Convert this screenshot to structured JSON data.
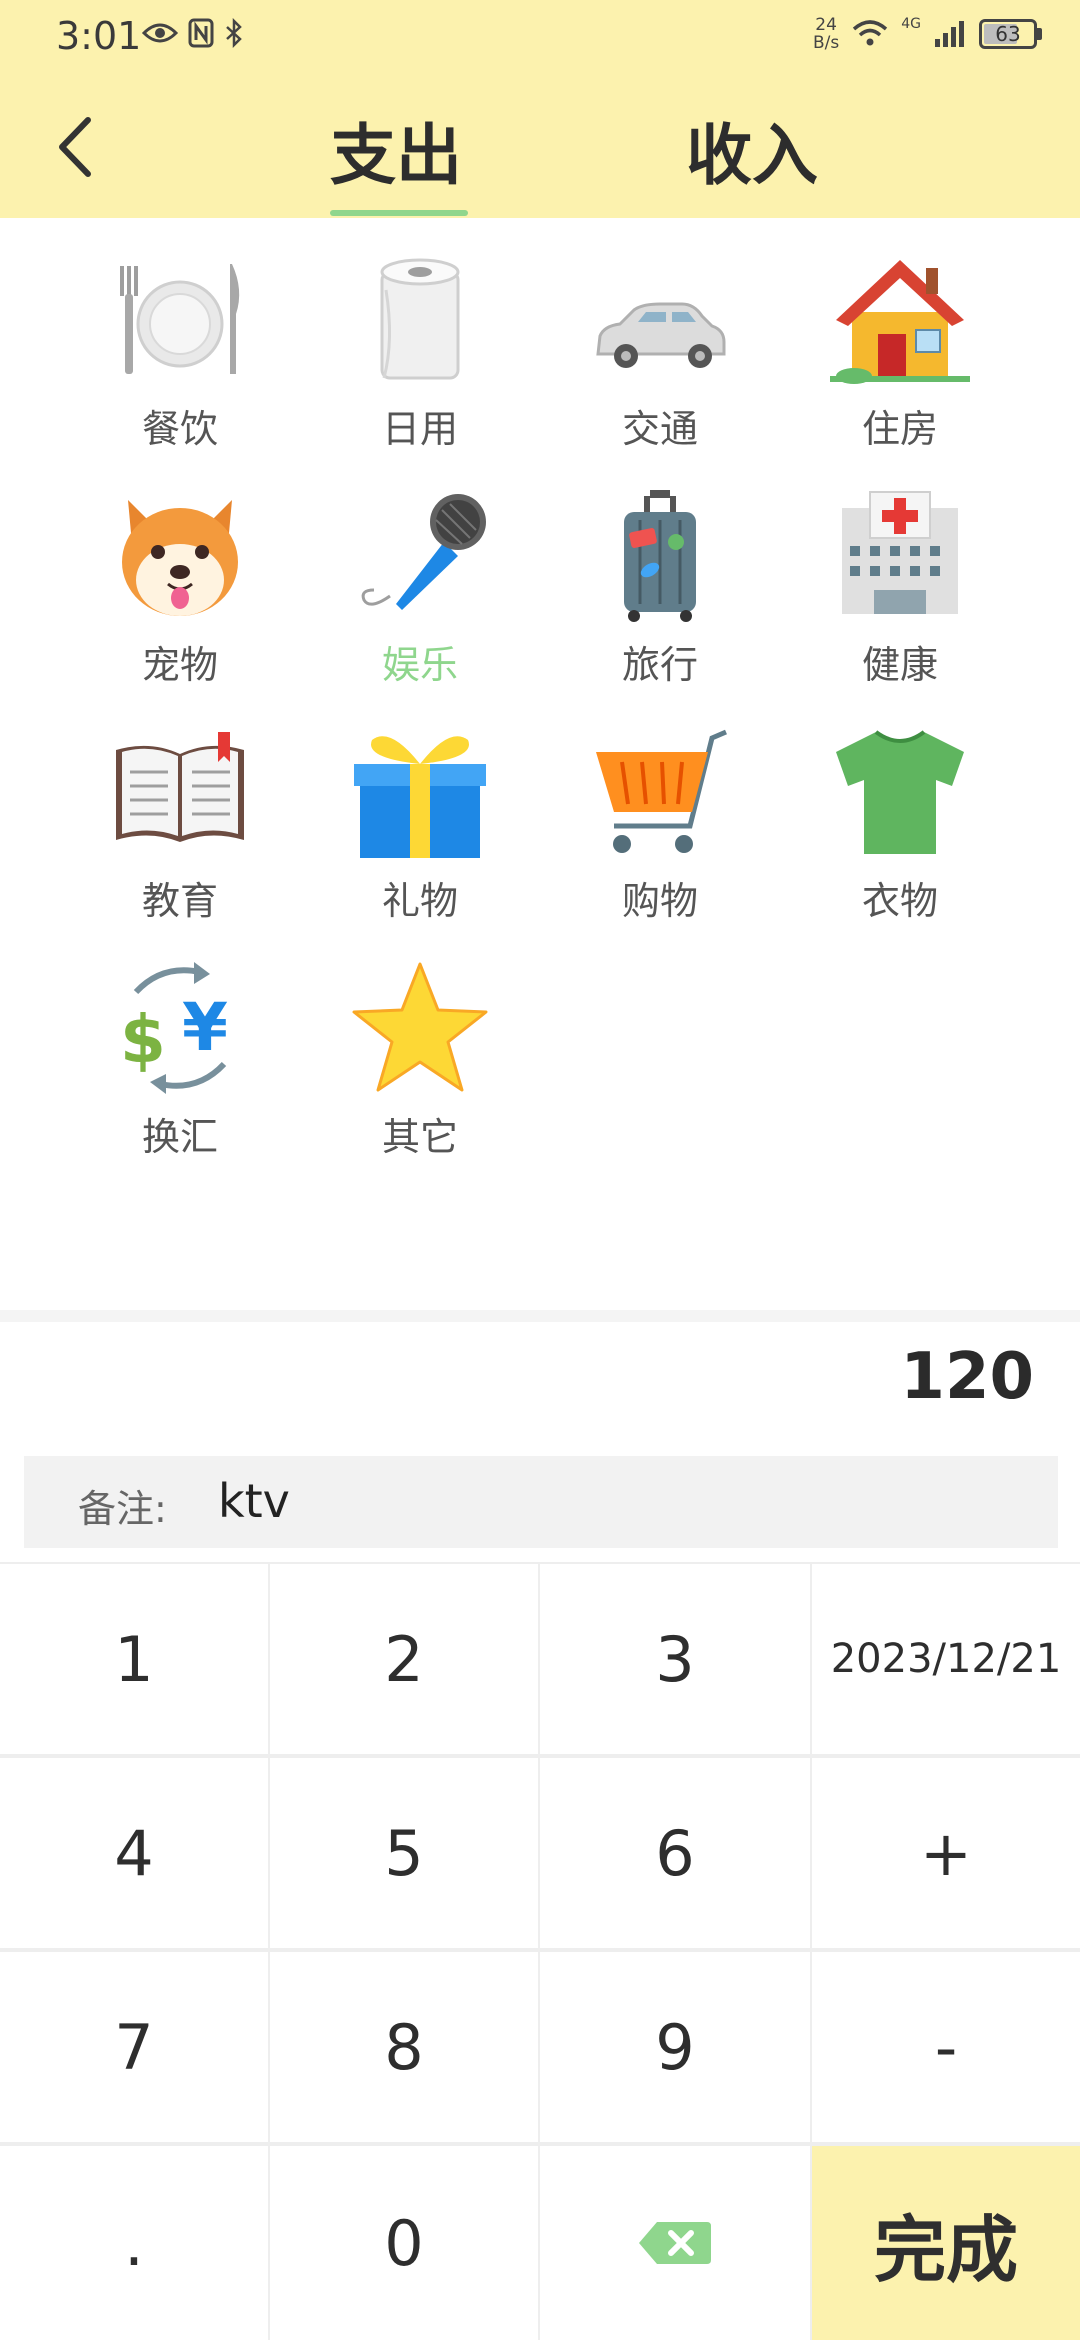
{
  "status_bar": {
    "time": "3:01",
    "net_speed_value": "24",
    "net_speed_unit": "B/s",
    "network_type": "4G",
    "battery": "63",
    "battery_level": 0.63,
    "left_icons": [
      "eye-icon",
      "nfc-icon",
      "bluetooth-icon"
    ],
    "right_icons": [
      "wifi-icon",
      "signal-icon",
      "battery-icon"
    ]
  },
  "header": {
    "back_icon": "chevron-left-icon",
    "tabs": [
      {
        "label": "支出",
        "active": true
      },
      {
        "label": "收入",
        "active": false
      }
    ]
  },
  "categories": [
    {
      "label": "餐饮",
      "icon": "plate-cutlery-icon"
    },
    {
      "label": "日用",
      "icon": "toilet-paper-icon"
    },
    {
      "label": "交通",
      "icon": "car-icon"
    },
    {
      "label": "住房",
      "icon": "house-icon"
    },
    {
      "label": "宠物",
      "icon": "dog-face-icon"
    },
    {
      "label": "娱乐",
      "icon": "microphone-icon",
      "active": true
    },
    {
      "label": "旅行",
      "icon": "luggage-icon"
    },
    {
      "label": "健康",
      "icon": "hospital-icon"
    },
    {
      "label": "教育",
      "icon": "open-book-icon"
    },
    {
      "label": "礼物",
      "icon": "gift-icon"
    },
    {
      "label": "购物",
      "icon": "shopping-cart-icon"
    },
    {
      "label": "衣物",
      "icon": "tshirt-icon"
    },
    {
      "label": "换汇",
      "icon": "currency-exchange-icon"
    },
    {
      "label": "其它",
      "icon": "star-icon"
    }
  ],
  "entry": {
    "amount": "120",
    "note_label": "备注:",
    "note_value": "ktv"
  },
  "keypad": {
    "keys": [
      "1",
      "2",
      "3",
      "2023/12/21",
      "4",
      "5",
      "6",
      "+",
      "7",
      "8",
      "9",
      "-",
      ".",
      "0",
      "",
      "完成"
    ],
    "backspace_icon": "backspace-icon"
  },
  "colors": {
    "header_bg": "#fcf2ae",
    "accent_green": "#8fd68d",
    "done_bg": "#fcf2ae"
  }
}
